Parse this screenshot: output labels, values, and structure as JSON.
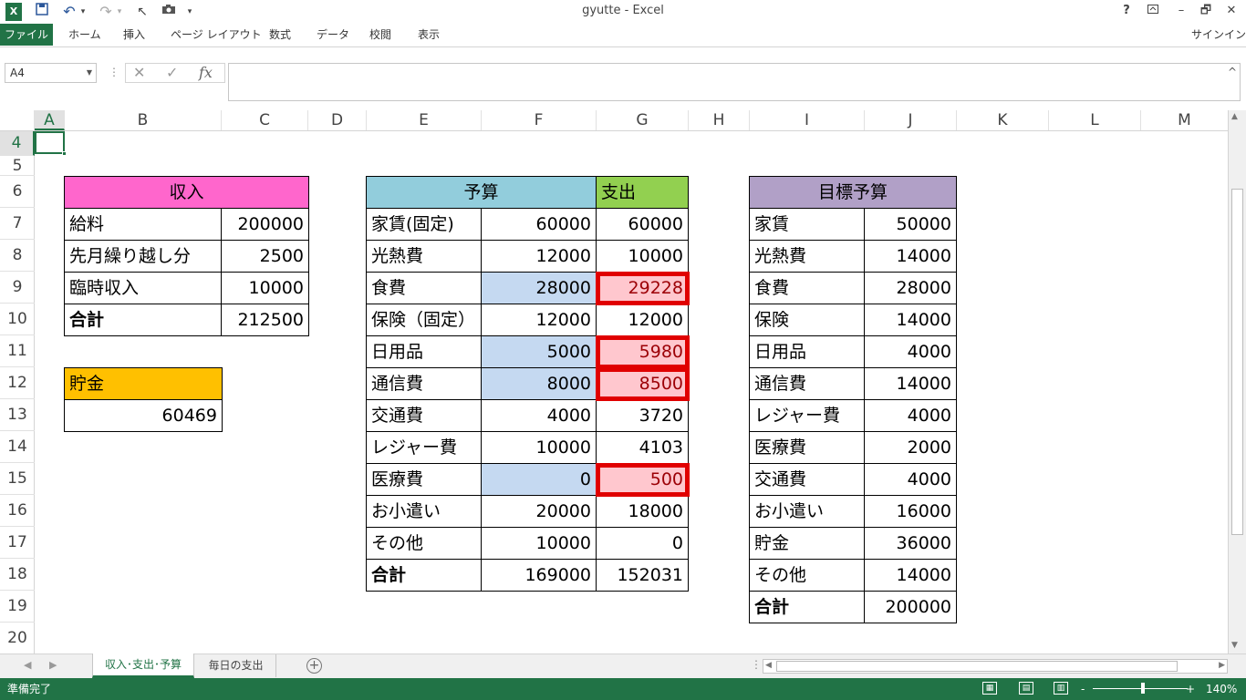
{
  "window": {
    "title": "gyutte - Excel",
    "help": "?",
    "minimize": "–",
    "restore": "🗗",
    "close": "✕"
  },
  "quick_access": {
    "excel_icon": "X",
    "save": "💾",
    "undo": "↶",
    "redo": "↷",
    "pointer": "↖",
    "camera": "📷",
    "customize": "▾"
  },
  "ribbon": {
    "file": "ファイル",
    "tabs": [
      "ホーム",
      "挿入",
      "ページ レイアウト",
      "数式",
      "データ",
      "校閲",
      "表示"
    ],
    "signin": "サインイン"
  },
  "formula_bar": {
    "name_box": "A4",
    "cancel": "✕",
    "enter": "✓",
    "fx": "fx",
    "value": "",
    "expand": "^"
  },
  "columns": [
    "A",
    "B",
    "C",
    "D",
    "E",
    "F",
    "G",
    "H",
    "I",
    "J",
    "K",
    "L",
    "M"
  ],
  "rows": [
    "4",
    "5",
    "6",
    "7",
    "8",
    "9",
    "10",
    "11",
    "12",
    "13",
    "14",
    "15",
    "16",
    "17",
    "18",
    "19",
    "20"
  ],
  "income": {
    "header": "収入",
    "rows": [
      {
        "label": "給料",
        "value": "200000"
      },
      {
        "label": "先月繰り越し分",
        "value": "2500"
      },
      {
        "label": "臨時収入",
        "value": "10000"
      },
      {
        "label": "合計",
        "value": "212500"
      }
    ]
  },
  "savings": {
    "header": "貯金",
    "value": "60469"
  },
  "budget": {
    "header_budget": "予算",
    "header_expense": "支出",
    "rows": [
      {
        "label": "家賃(固定)",
        "budget": "60000",
        "expense": "60000"
      },
      {
        "label": "光熱費",
        "budget": "12000",
        "expense": "10000"
      },
      {
        "label": "食費",
        "budget": "28000",
        "expense": "29228"
      },
      {
        "label": "保険（固定）",
        "budget": "12000",
        "expense": "12000"
      },
      {
        "label": "日用品",
        "budget": "5000",
        "expense": "5980"
      },
      {
        "label": "通信費",
        "budget": "8000",
        "expense": "8500"
      },
      {
        "label": "交通費",
        "budget": "4000",
        "expense": "3720"
      },
      {
        "label": "レジャー費",
        "budget": "10000",
        "expense": "4103"
      },
      {
        "label": "医療費",
        "budget": "0",
        "expense": "500"
      },
      {
        "label": "お小遣い",
        "budget": "20000",
        "expense": "18000"
      },
      {
        "label": "その他",
        "budget": "10000",
        "expense": "0"
      },
      {
        "label": "合計",
        "budget": "169000",
        "expense": "152031"
      }
    ]
  },
  "target": {
    "header": "目標予算",
    "rows": [
      {
        "label": "家賃",
        "value": "50000"
      },
      {
        "label": "光熱費",
        "value": "14000"
      },
      {
        "label": "食費",
        "value": "28000"
      },
      {
        "label": "保険",
        "value": "14000"
      },
      {
        "label": "日用品",
        "value": "4000"
      },
      {
        "label": "通信費",
        "value": "14000"
      },
      {
        "label": "レジャー費",
        "value": "4000"
      },
      {
        "label": "医療費",
        "value": "2000"
      },
      {
        "label": "交通費",
        "value": "4000"
      },
      {
        "label": "お小遣い",
        "value": "16000"
      },
      {
        "label": "貯金",
        "value": "36000"
      },
      {
        "label": "その他",
        "value": "14000"
      },
      {
        "label": "合計",
        "value": "200000"
      }
    ]
  },
  "sheets": {
    "active": "収入･支出･予算",
    "other": "毎日の支出",
    "add": "+"
  },
  "status": {
    "ready": "準備完了",
    "zoom": "140%",
    "zoom_minus": "-",
    "zoom_plus": "+"
  }
}
